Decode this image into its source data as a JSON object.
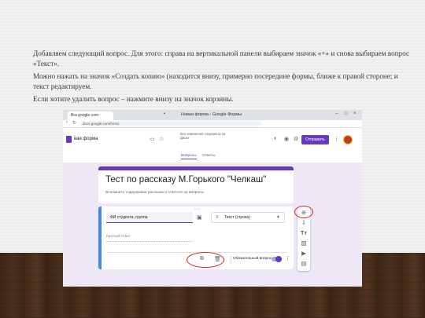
{
  "instructions": {
    "p1": "Добавляем следующий вопрос. Для этого: справа на вертикальной панели выбираем значок «+» и снова выбираем вопрос «Текст».",
    "p2": "Можно нажать на значок «Создать копию» (находится внизу, примерно посередине формы, ближе к правой стороне; и текст редактируем.",
    "p3": "Если хотите удалить вопрос – нажмите внизу на значок корзины."
  },
  "browser": {
    "tab_title": "Bra google.com",
    "window_title": "Новая форма - Google Формы",
    "address": "docs.google.com/forms"
  },
  "form_header": {
    "name": "вая форма",
    "saved_status": "Все изменения сохранены на Диске",
    "send_label": "Отправить"
  },
  "form_tabs": [
    "Вопросы",
    "Ответы"
  ],
  "form": {
    "title": "Тест по рассказу М.Горького \"Челкаш\"",
    "description": "Вспомните содержание рассказа и ответьте на вопросы"
  },
  "question": {
    "text": "ФИ студента, группа",
    "type": "Текст (строка)",
    "answer_placeholder": "Краткий ответ",
    "required_label": "Обязательный вопрос",
    "required": true
  },
  "side_panel_icons": [
    "add-circle-icon",
    "import-icon",
    "title-text-icon",
    "image-icon",
    "video-icon",
    "section-icon"
  ],
  "colors": {
    "accent": "#673ab7",
    "background": "#ede7f6",
    "highlight": "#e02020",
    "question_border": "#4285f4"
  }
}
